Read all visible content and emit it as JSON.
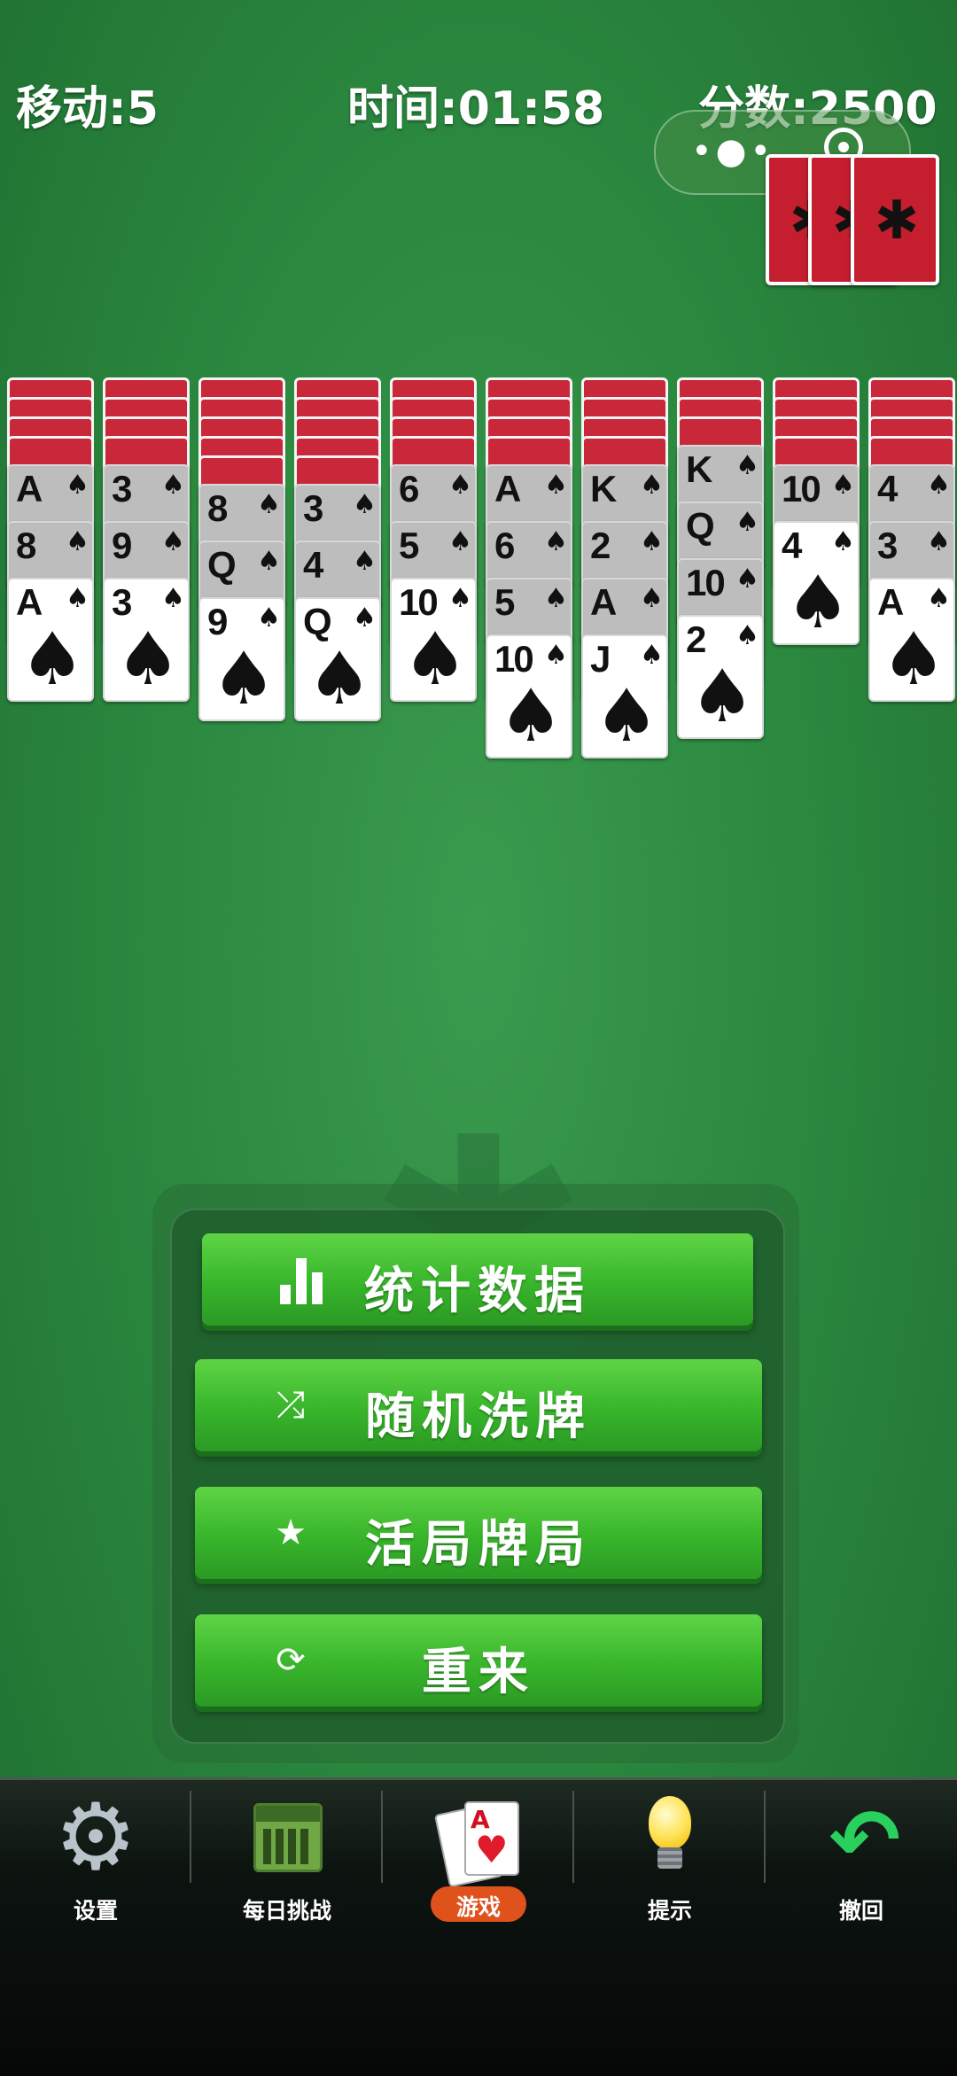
{
  "hud": {
    "moves": "移动:5",
    "time": "时间:01:58",
    "score": "分数:2500"
  },
  "mini_program_capsule": {
    "more_icon": "more-dots-icon",
    "close_icon": "target-close-icon"
  },
  "stock": {
    "remaining_deals": 3,
    "back_icon": "spider-icon"
  },
  "tableau": [
    {
      "face_down": 4,
      "face_up": [
        {
          "rank": "A",
          "suit": "♠",
          "dim": true
        },
        {
          "rank": "8",
          "suit": "♠",
          "dim": true
        },
        {
          "rank": "A",
          "suit": "♠",
          "dim": false
        }
      ]
    },
    {
      "face_down": 4,
      "face_up": [
        {
          "rank": "3",
          "suit": "♠",
          "dim": true
        },
        {
          "rank": "9",
          "suit": "♠",
          "dim": true
        },
        {
          "rank": "3",
          "suit": "♠",
          "dim": false
        }
      ]
    },
    {
      "face_down": 5,
      "face_up": [
        {
          "rank": "8",
          "suit": "♠",
          "dim": true
        },
        {
          "rank": "Q",
          "suit": "♠",
          "dim": true
        },
        {
          "rank": "9",
          "suit": "♠",
          "dim": false
        }
      ]
    },
    {
      "face_down": 5,
      "face_up": [
        {
          "rank": "3",
          "suit": "♠",
          "dim": true
        },
        {
          "rank": "4",
          "suit": "♠",
          "dim": true
        },
        {
          "rank": "Q",
          "suit": "♠",
          "dim": false
        }
      ]
    },
    {
      "face_down": 4,
      "face_up": [
        {
          "rank": "6",
          "suit": "♠",
          "dim": true
        },
        {
          "rank": "5",
          "suit": "♠",
          "dim": true
        },
        {
          "rank": "10",
          "suit": "♠",
          "dim": false
        }
      ]
    },
    {
      "face_down": 4,
      "face_up": [
        {
          "rank": "A",
          "suit": "♠",
          "dim": true
        },
        {
          "rank": "6",
          "suit": "♠",
          "dim": true
        },
        {
          "rank": "5",
          "suit": "♠",
          "dim": true
        },
        {
          "rank": "10",
          "suit": "♠",
          "dim": false
        }
      ]
    },
    {
      "face_down": 4,
      "face_up": [
        {
          "rank": "K",
          "suit": "♠",
          "dim": true
        },
        {
          "rank": "2",
          "suit": "♠",
          "dim": true
        },
        {
          "rank": "A",
          "suit": "♠",
          "dim": true
        },
        {
          "rank": "J",
          "suit": "♠",
          "dim": false
        }
      ]
    },
    {
      "face_down": 3,
      "face_up": [
        {
          "rank": "K",
          "suit": "♠",
          "dim": true
        },
        {
          "rank": "Q",
          "suit": "♠",
          "dim": true
        },
        {
          "rank": "10",
          "suit": "♠",
          "dim": true
        },
        {
          "rank": "2",
          "suit": "♠",
          "dim": false
        }
      ]
    },
    {
      "face_down": 4,
      "face_up": [
        {
          "rank": "10",
          "suit": "♠",
          "dim": true
        },
        {
          "rank": "4",
          "suit": "♠",
          "dim": false
        }
      ]
    },
    {
      "face_down": 4,
      "face_up": [
        {
          "rank": "4",
          "suit": "♠",
          "dim": true
        },
        {
          "rank": "3",
          "suit": "♠",
          "dim": true
        },
        {
          "rank": "A",
          "suit": "♠",
          "dim": false
        }
      ]
    }
  ],
  "menu": {
    "stats_label": "统计数据",
    "stats_icon": "bar-chart-icon",
    "random_label": "随机洗牌",
    "random_icon": "shuffle-icon",
    "winnable_label": "活局牌局",
    "winnable_icon": "star-icon",
    "restart_label": "重来",
    "restart_icon": "refresh-icon"
  },
  "bottom_nav": {
    "settings": "设置",
    "daily": "每日挑战",
    "game": "游戏",
    "hint": "提示",
    "undo": "撤回",
    "active": "游戏",
    "active_color": "#e0521c"
  },
  "colors": {
    "felt": "#2c8a40",
    "card_back": "#c8283a",
    "button_green": "#38b52b"
  }
}
